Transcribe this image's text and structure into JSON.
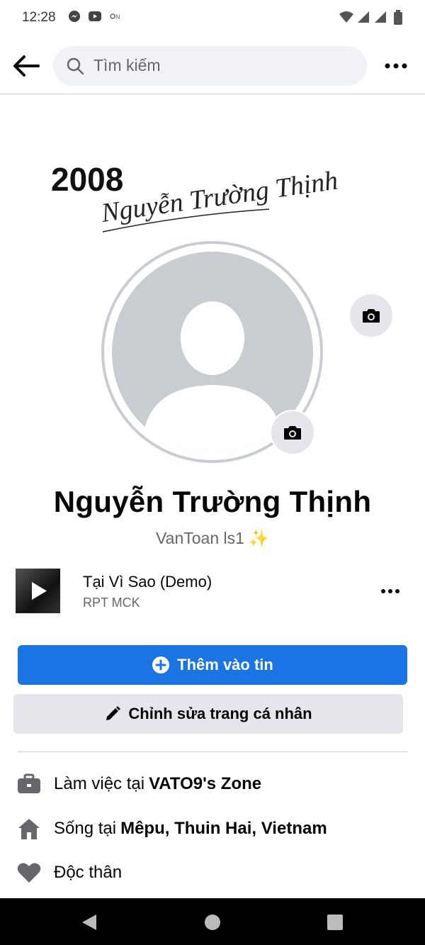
{
  "status_bar": {
    "time": "12:28"
  },
  "search": {
    "placeholder": "Tìm kiếm"
  },
  "cover": {
    "year": "2008",
    "signature": "Nguyễn Trường Thịnh"
  },
  "profile": {
    "name": "Nguyễn Trường Thịnh",
    "bio": "VanToan ls1",
    "bio_emoji": "✨"
  },
  "music": {
    "title": "Tại Vì Sao (Demo)",
    "artist": "RPT MCK"
  },
  "actions": {
    "add_story": "Thêm vào tin",
    "edit_profile": "Chỉnh sửa trang cá nhân"
  },
  "details": [
    {
      "icon": "briefcase-icon",
      "prefix": "Làm việc tại",
      "value": "VATO9's Zone"
    },
    {
      "icon": "home-icon",
      "prefix": "Sống tại",
      "value": "Mêpu, Thuin Hai, Vietnam"
    },
    {
      "icon": "heart-icon",
      "prefix": "Độc thân",
      "value": ""
    }
  ],
  "colors": {
    "primary": "#1b74e4",
    "secondary_bg": "#e4e6eb",
    "muted_text": "#65676b"
  }
}
